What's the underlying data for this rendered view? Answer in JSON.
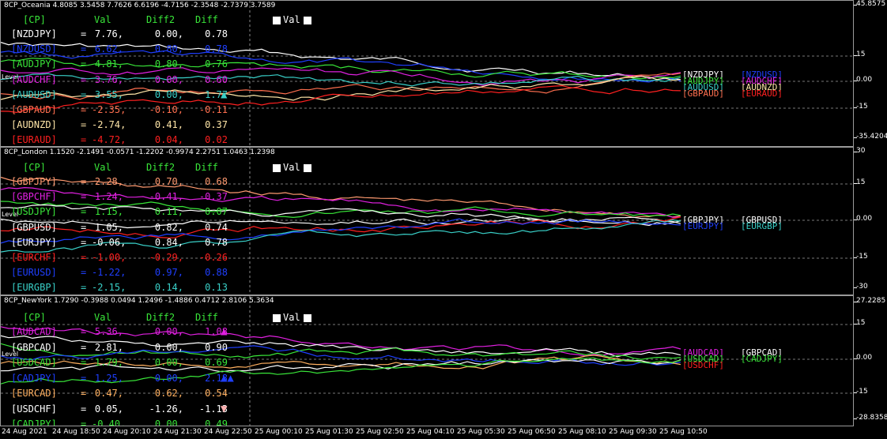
{
  "panes": [
    {
      "title": "8CP_Oceania 4.8085 3.5458 7.7626 6.6196 -4.7156 -2.3548 -2.7379 3.7589",
      "header": {
        "cp": "[CP]",
        "val": "Val",
        "diff2": "Diff2",
        "diff": "Diff"
      },
      "legend": "Val",
      "zero_label": "Level",
      "rows": [
        {
          "sym": "[NZDJPY]",
          "val": "7.76,",
          "d2": "0.00,",
          "df": "0.78",
          "color": "#ffffff"
        },
        {
          "sym": "[NZDUSD]",
          "val": "6.62,",
          "d2": "0.80,",
          "df": "0.78",
          "color": "#1f3fff"
        },
        {
          "sym": "[AUDJPY]",
          "val": "4.81,",
          "d2": "0.80,",
          "df": "0.76",
          "color": "#39e639"
        },
        {
          "sym": "[AUDCHF]",
          "val": "3.76,",
          "d2": "0.00,",
          "df": "0.60",
          "color": "#e020e0"
        },
        {
          "sym": "[AUDUSD]",
          "val": "3.55,",
          "d2": "0.00,",
          "df": "1.77",
          "color": "#39d0c8",
          "arrow": "▲",
          "arrow_color": "#39d0c8"
        },
        {
          "sym": "[GBPAUD]",
          "val": "-2.35,",
          "d2": "-0.10,",
          "df": "-0.11",
          "color": "#ff6f4f"
        },
        {
          "sym": "[AUDNZD]",
          "val": "-2.74,",
          "d2": "0.41,",
          "df": "0.37",
          "color": "#ffe6a8"
        },
        {
          "sym": "[EURAUD]",
          "val": "-4.72,",
          "d2": "0.04,",
          "df": "0.02",
          "color": "#ff2020"
        }
      ],
      "labels": [
        {
          "text": "[NZDJPY]",
          "color": "#ffffff"
        },
        {
          "text": "[NZDUSD]",
          "color": "#1f3fff"
        },
        {
          "text": "[AUDJPY]",
          "color": "#39e639"
        },
        {
          "text": "[AUDCHF]",
          "color": "#e020e0"
        },
        {
          "text": "[AUDUSD]",
          "color": "#39d0c8"
        },
        {
          "text": "[AUDNZD]",
          "color": "#ffe6a8"
        },
        {
          "text": "[GBPAUD]",
          "color": "#ff6f4f"
        },
        {
          "text": "[EURAUD]",
          "color": "#ff2020"
        }
      ],
      "axis": [
        "45.8575",
        "15",
        "0.00",
        "-15",
        "-35.4204"
      ]
    },
    {
      "title": "8CP_London 1.1520 -2.1491 -0.0571 -1.2202 -0.9974 2.2751 1.0463 1.2398",
      "header": {
        "cp": "[CP]",
        "val": "Val",
        "diff2": "Diff2",
        "diff": "Diff"
      },
      "legend": "Val",
      "zero_label": "Level",
      "rows": [
        {
          "sym": "[GBPJPY]",
          "val": "2.28,",
          "d2": "0.70,",
          "df": "0.68",
          "color": "#ff9a70"
        },
        {
          "sym": "[GBPCHF]",
          "val": "1.24,",
          "d2": "-0.41,",
          "df": "-0.37",
          "color": "#e020e0"
        },
        {
          "sym": "[USDJPY]",
          "val": "1.15,",
          "d2": "0.11,",
          "df": "0.07",
          "color": "#39e639"
        },
        {
          "sym": "[GBPUSD]",
          "val": "1.05,",
          "d2": "0.82,",
          "df": "0.74",
          "color": "#ffffff"
        },
        {
          "sym": "[EURJPY]",
          "val": "-0.06,",
          "d2": "0.84,",
          "df": "0.78",
          "color": "#ffffff"
        },
        {
          "sym": "[EURCHF]",
          "val": "-1.00,",
          "d2": "-0.29,",
          "df": "-0.26",
          "color": "#ff2020"
        },
        {
          "sym": "[EURUSD]",
          "val": "-1.22,",
          "d2": "0.97,",
          "df": "0.88",
          "color": "#1f3fff"
        },
        {
          "sym": "[EURGBP]",
          "val": "-2.15,",
          "d2": "0.14,",
          "df": "0.13",
          "color": "#39d0c8"
        }
      ],
      "labels": [
        {
          "text": "[GBPJPY]",
          "color": "#ffffff"
        },
        {
          "text": "[GBPUSD]",
          "color": "#ffffff"
        },
        {
          "text": "[EURJPY]",
          "color": "#1f3fff"
        },
        {
          "text": "[EURGBP]",
          "color": "#39d0c8"
        }
      ],
      "axis": [
        "30",
        "15",
        "0.00",
        "-15",
        "-30"
      ]
    },
    {
      "title": "8CP_NewYork 1.7290 -0.3988 0.0494 1.2496 -1.4886 0.4712 2.8106 5.3634",
      "header": {
        "cp": "[CP]",
        "val": "Val",
        "diff2": "Diff2",
        "diff": "Diff"
      },
      "legend": "Val",
      "zero_label": "Level",
      "rows": [
        {
          "sym": "[AUDCAD]",
          "val": "5.36,",
          "d2": "0.00,",
          "df": "1.08",
          "color": "#e020e0",
          "arrow": "▲",
          "arrow_color": "#e020e0"
        },
        {
          "sym": "[GBPCAD]",
          "val": "2.81,",
          "d2": "0.00,",
          "df": "0.90",
          "color": "#ffffff"
        },
        {
          "sym": "[USDCAD]",
          "val": "1.79,",
          "d2": "0.00,",
          "df": "0.69",
          "color": "#39e639"
        },
        {
          "sym": "[CADJPY]",
          "val": "1.25,",
          "d2": "0.00,",
          "df": "2.18",
          "color": "#1f3fff",
          "arrow": "▲▲",
          "arrow_color": "#1f3fff"
        },
        {
          "sym": "[EURCAD]",
          "val": "0.47,",
          "d2": "0.62,",
          "df": "0.54",
          "color": "#ffb060"
        },
        {
          "sym": "[USDCHF]",
          "val": "0.05,",
          "d2": "-1.26,",
          "df": "-1.13",
          "color": "#ffffff",
          "arrow": "▼",
          "arrow_color": "#ffb0b0"
        },
        {
          "sym": "[CADJPY]",
          "val": "-0.40,",
          "d2": "0.00,",
          "df": "0.49",
          "color": "#39e639"
        }
      ],
      "labels": [
        {
          "text": "[AUDCAD]",
          "color": "#e020e0"
        },
        {
          "text": "[GBPCAD]",
          "color": "#ffffff"
        },
        {
          "text": "[USDCAD]",
          "color": "#39e639"
        },
        {
          "text": "[CADJPY]",
          "color": "#39e639"
        },
        {
          "text": "[USDCHF]",
          "color": "#ff2020"
        }
      ],
      "axis": [
        "27.2285",
        "15",
        "0.00",
        "-15",
        "-28.8358"
      ]
    }
  ],
  "time_axis": [
    "24 Aug 2021",
    "24 Aug 18:50",
    "24 Aug 20:10",
    "24 Aug 21:30",
    "24 Aug 22:50",
    "25 Aug 00:10",
    "25 Aug 01:30",
    "25 Aug 02:50",
    "25 Aug 04:10",
    "25 Aug 05:30",
    "25 Aug 06:50",
    "25 Aug 08:10",
    "25 Aug 09:30",
    "25 Aug 10:50"
  ],
  "colors": {
    "grid": "#777777",
    "header": "#39e639",
    "separator": "#9a9a9a"
  }
}
